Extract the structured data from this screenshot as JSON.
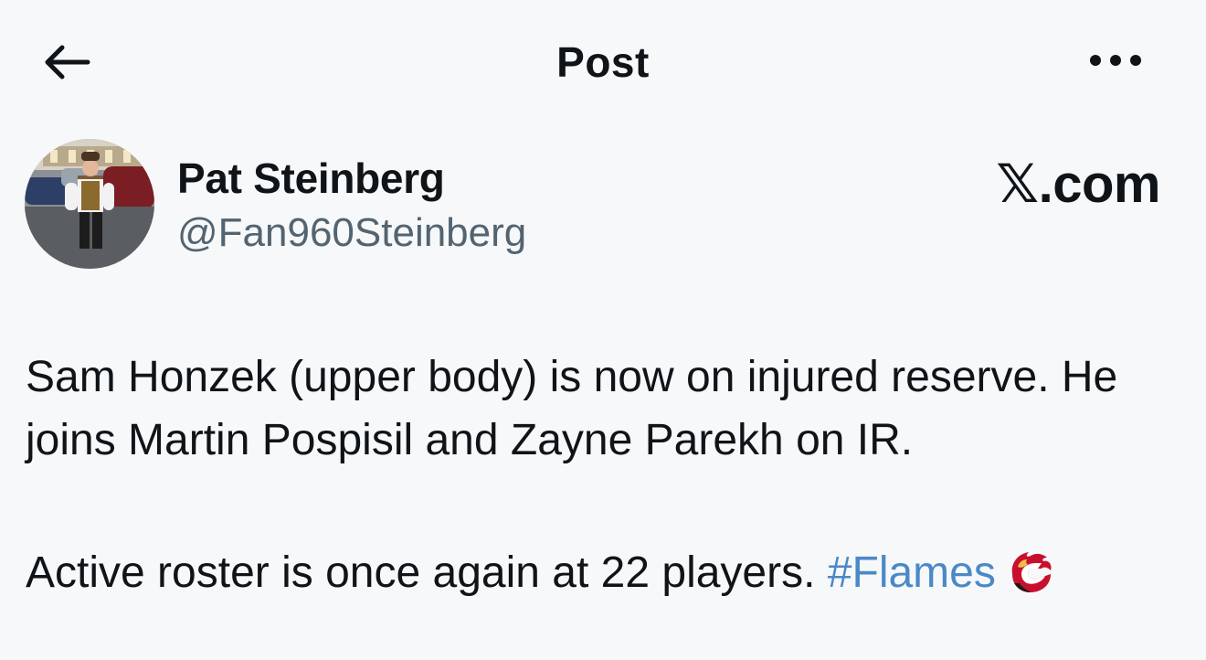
{
  "header": {
    "title": "Post",
    "back_icon": "arrow-left-icon",
    "more_icon": "more-horizontal-icon"
  },
  "author": {
    "name": "Pat Steinberg",
    "handle": "@Fan960Steinberg",
    "avatar_icon": "profile-photo"
  },
  "brand": {
    "label": "𝕏.com"
  },
  "tweet": {
    "line1": "Sam Honzek (upper body) is now on injured reserve. He joins Martin Pospisil and Zayne Parekh on IR.",
    "line2_text": "Active roster is once again at 22 players.",
    "hashtag": "#Flames",
    "emoji_icon": "flames-logo-icon"
  },
  "colors": {
    "background": "#f7f8f9",
    "text": "#0f1419",
    "secondary_text": "#536471",
    "hashtag": "#4a89c8",
    "logo_red": "#c8102e",
    "logo_gold": "#f1be48"
  }
}
